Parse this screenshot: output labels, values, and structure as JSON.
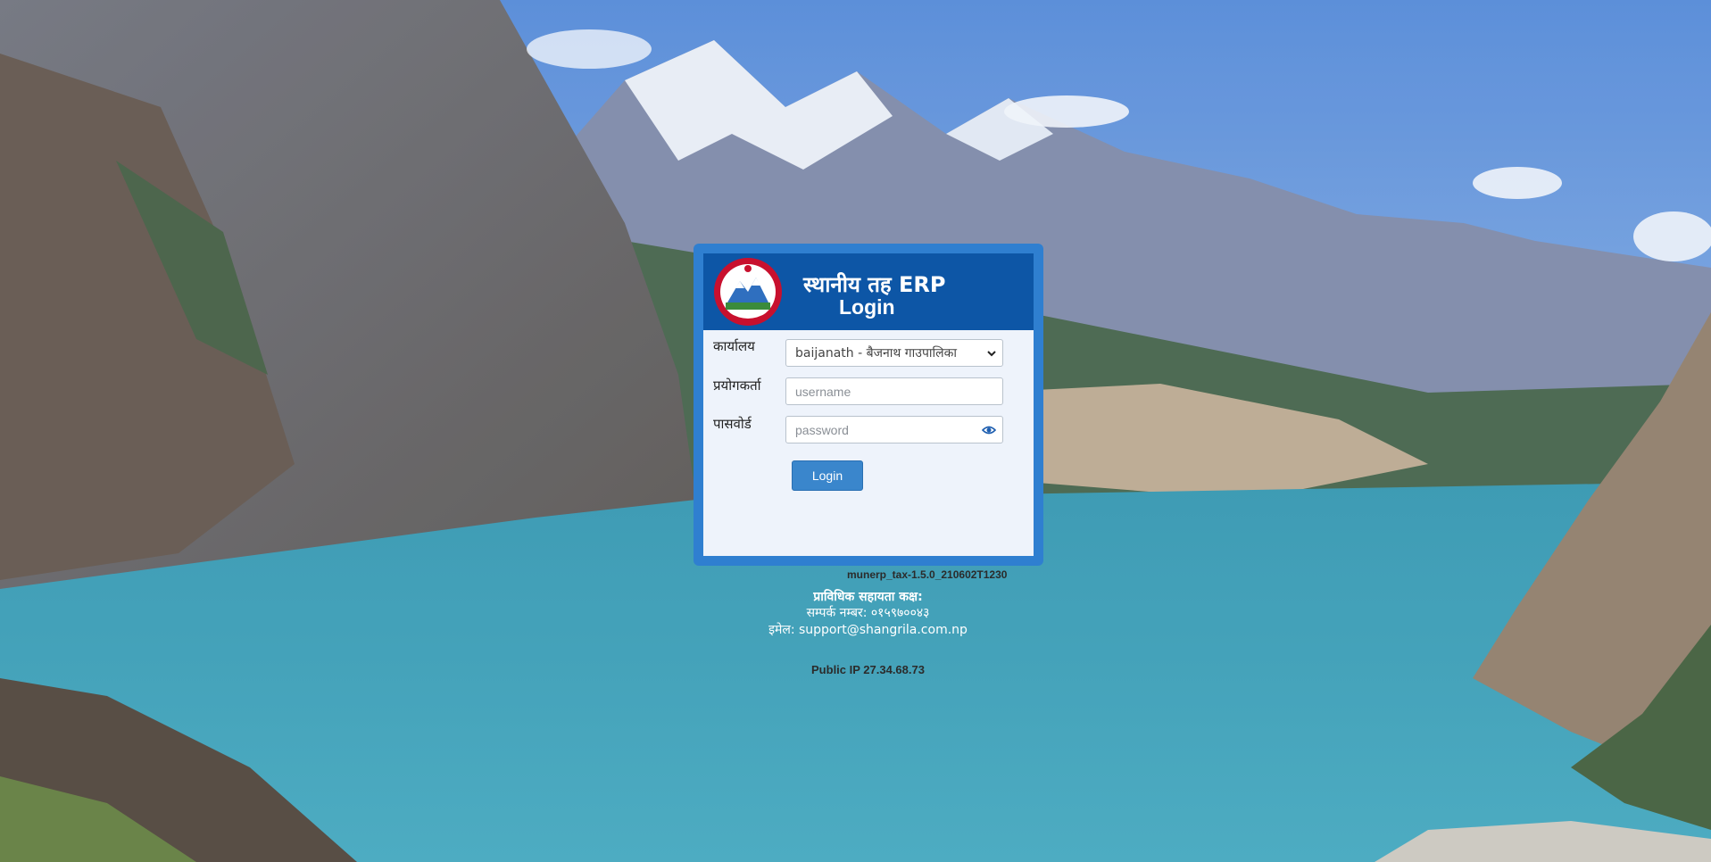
{
  "header": {
    "title": "स्थानीय तह ERP",
    "subtitle": "Login"
  },
  "form": {
    "office_label": "कार्यालय",
    "office_value": "baijanath - बैजनाथ गाउपालिका",
    "user_label": "प्रयोगकर्ता",
    "user_placeholder": "username",
    "password_label": "पासवोर्ड",
    "password_placeholder": "password",
    "login_label": "Login"
  },
  "footer": {
    "version": "munerp_tax-1.5.0_210602T1230",
    "support_title": "प्राविधिक सहायता कक्ष:",
    "contact": "सम्पर्क नम्बर: ०१५९७००४३",
    "email": "इमेल: support@shangrila.com.np",
    "public_ip": "Public IP 27.34.68.73"
  },
  "icons": {
    "emblem": "nepal-emblem-icon",
    "select_arrow": "chevron-down-icon",
    "show_password": "eye-icon"
  },
  "colors": {
    "panel_border": "#2f7fd0",
    "header_bg": "#0d56a6",
    "body_bg": "#eef3fb",
    "button_bg": "#3a86cc"
  }
}
